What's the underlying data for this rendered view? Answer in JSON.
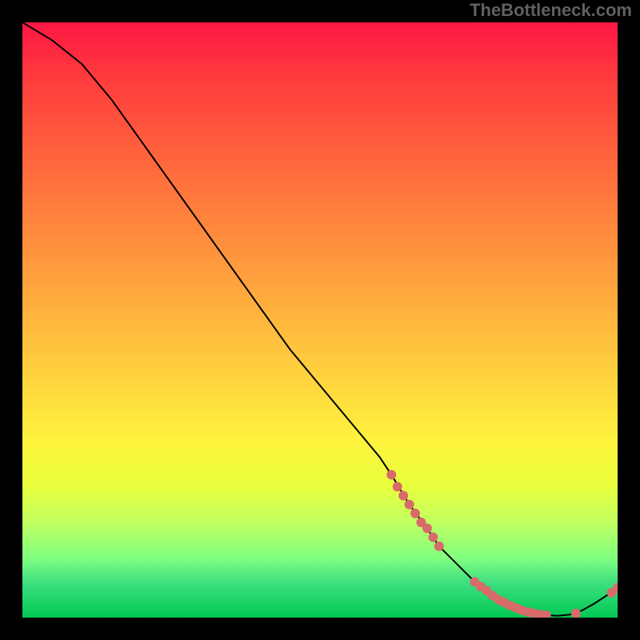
{
  "attribution": "TheBottleneck.com",
  "chart_data": {
    "type": "line",
    "title": "",
    "xlabel": "",
    "ylabel": "",
    "xlim": [
      0,
      100
    ],
    "ylim": [
      0,
      100
    ],
    "curve": {
      "name": "bottleneck-curve",
      "x": [
        0,
        5,
        10,
        15,
        20,
        25,
        30,
        35,
        40,
        45,
        50,
        55,
        60,
        62,
        65,
        68,
        70,
        72,
        74,
        76,
        78,
        80,
        82,
        84,
        86,
        88,
        90,
        92,
        94,
        96,
        98,
        100
      ],
      "y": [
        100,
        97,
        93,
        87,
        80,
        73,
        66,
        59,
        52,
        45,
        39,
        33,
        27,
        24,
        19,
        15,
        12,
        10,
        8,
        6,
        4.5,
        3,
        2,
        1.2,
        0.7,
        0.4,
        0.3,
        0.5,
        1.2,
        2.3,
        3.6,
        5
      ]
    },
    "markers": {
      "name": "highlight-points",
      "color": "#d96a6a",
      "points": [
        {
          "x": 62,
          "y": 24
        },
        {
          "x": 63,
          "y": 22
        },
        {
          "x": 64,
          "y": 20.5
        },
        {
          "x": 65,
          "y": 19
        },
        {
          "x": 66,
          "y": 17.5
        },
        {
          "x": 67,
          "y": 16
        },
        {
          "x": 68,
          "y": 15
        },
        {
          "x": 69,
          "y": 13.5
        },
        {
          "x": 70,
          "y": 12
        },
        {
          "x": 76,
          "y": 6
        },
        {
          "x": 77,
          "y": 5.2
        },
        {
          "x": 78,
          "y": 4.5
        },
        {
          "x": 79,
          "y": 3.7
        },
        {
          "x": 80,
          "y": 3
        },
        {
          "x": 81,
          "y": 2.5
        },
        {
          "x": 82,
          "y": 2
        },
        {
          "x": 83,
          "y": 1.6
        },
        {
          "x": 84,
          "y": 1.2
        },
        {
          "x": 85,
          "y": 0.9
        },
        {
          "x": 86,
          "y": 0.7
        },
        {
          "x": 87,
          "y": 0.5
        },
        {
          "x": 88,
          "y": 0.4
        },
        {
          "x": 93,
          "y": 0.7
        },
        {
          "x": 99,
          "y": 4.2
        },
        {
          "x": 100,
          "y": 5
        }
      ]
    }
  }
}
